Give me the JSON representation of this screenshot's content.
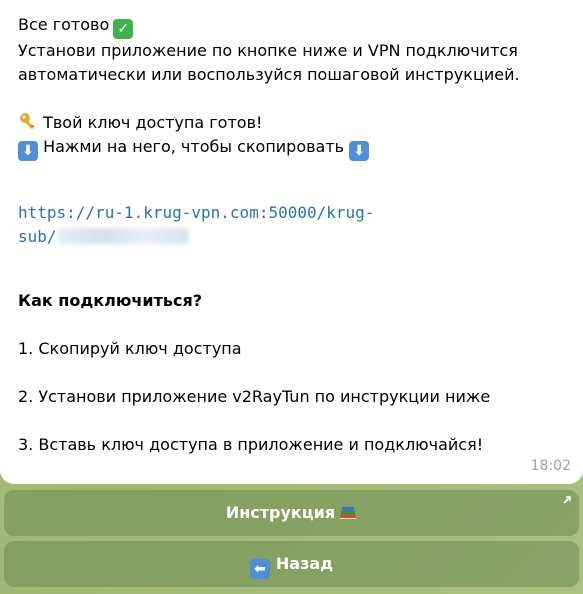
{
  "message": {
    "line1": "Все готово",
    "line2": "Установи приложение по кнопке ниже и VPN подключится",
    "line3": "автоматически или воспользуйся пошаговой инструкцией.",
    "key_ready": "Твой ключ доступа готов!",
    "tap_to_copy": "Нажми на него, чтобы скопировать",
    "link_part1": "https://ru-1.krug-vpn.com:50000/krug-",
    "link_part2": "sub/",
    "how_title": "Как подключиться?",
    "step1": "1. Скопируй ключ доступа",
    "step2": "2. Установи приложение v2RayTun по инструкции ниже",
    "step3": "3. Вставь ключ доступа в приложение и подключайся!",
    "time": "18:02"
  },
  "icons": {
    "check": "check-mark-button-icon",
    "key": "key-icon",
    "down_arrow": "down-arrow-icon",
    "books": "books-icon",
    "back": "back-arrow-icon"
  },
  "keyboard": {
    "instruction_label": "Инструкция",
    "back_label": "Назад"
  },
  "colors": {
    "link": "#2a70b8",
    "check_green": "#3fb24a",
    "arrow_blue": "#4f8ed9"
  }
}
